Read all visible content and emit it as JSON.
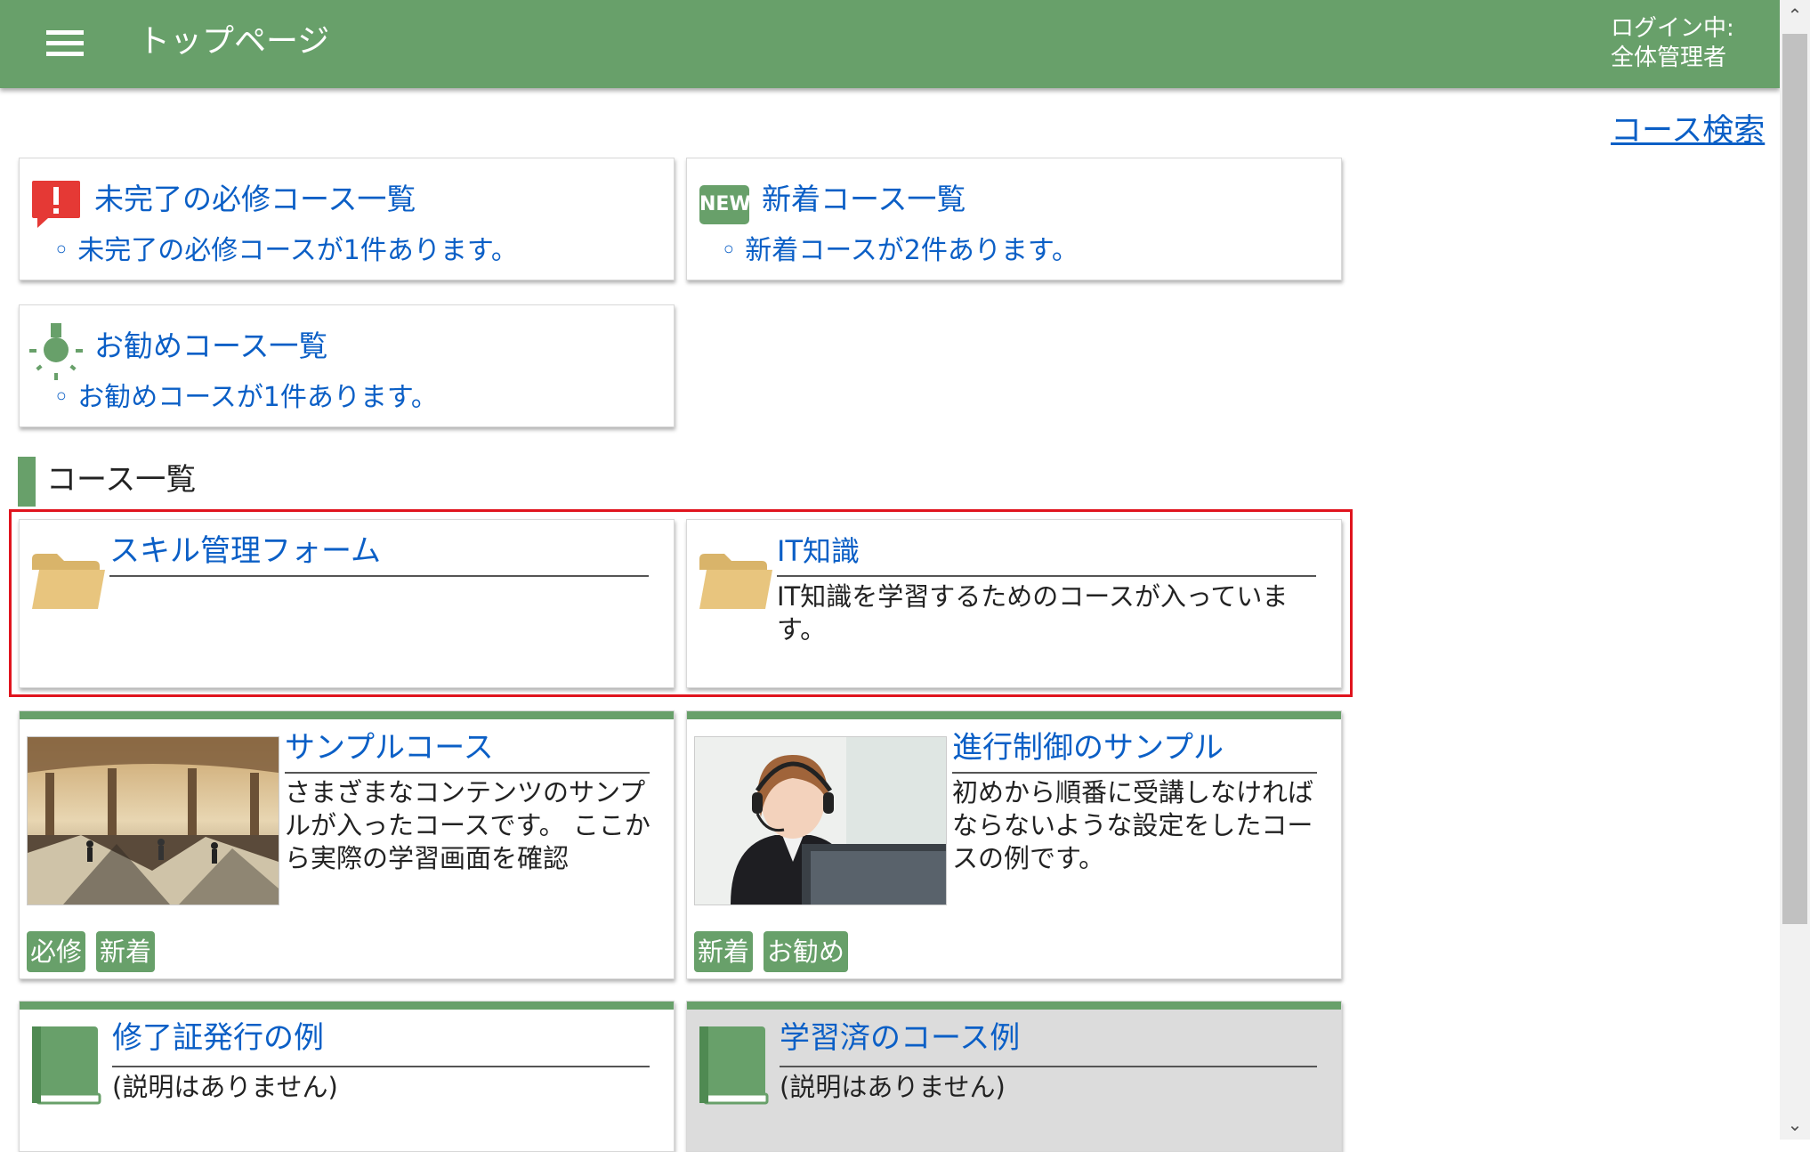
{
  "header": {
    "title": "トップページ",
    "login_label": "ログイン中:",
    "login_user": "全体管理者"
  },
  "search_link": "コース検索",
  "summary": {
    "required": {
      "title": "未完了の必修コース一覧",
      "text": "未完了の必修コースが1件あります。"
    },
    "new": {
      "title": "新着コース一覧",
      "text": "新着コースが2件あります。",
      "badge": "NEW"
    },
    "recommended": {
      "title": "お勧めコース一覧",
      "text": "お勧めコースが1件あります。"
    }
  },
  "section_title": "コース一覧",
  "folders": [
    {
      "title": "スキル管理フォーム",
      "desc": ""
    },
    {
      "title": "IT知識",
      "desc": "IT知識を学習するためのコースが入っています。"
    }
  ],
  "courses": [
    {
      "title": "サンプルコース",
      "desc": "さまざまなコンテンツのサンプルが入ったコースです。 ここから実際の学習画面を確認",
      "tags": [
        "必修",
        "新着"
      ]
    },
    {
      "title": "進行制御のサンプル",
      "desc": "初めから順番に受講しなければならないような設定をしたコースの例です。",
      "tags": [
        "新着",
        "お勧め"
      ]
    },
    {
      "title": "修了証発行の例",
      "desc": "(説明はありません)"
    },
    {
      "title": "学習済のコース例",
      "desc": "(説明はありません)"
    }
  ],
  "colors": {
    "header": "#68a06a",
    "link": "#0b5fc6",
    "alert": "#e53935",
    "highlight": "#e0141e"
  },
  "icons": [
    "hamburger-icon",
    "alert-icon",
    "new-icon",
    "bulb-icon",
    "folder-icon",
    "book-icon"
  ]
}
